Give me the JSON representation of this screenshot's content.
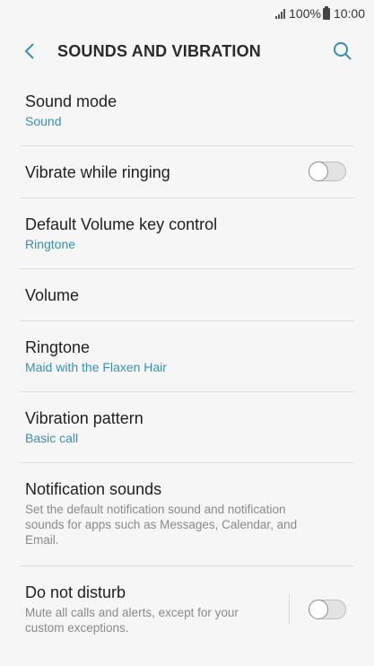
{
  "status": {
    "battery": "100%",
    "time": "10:00"
  },
  "header": {
    "title": "SOUNDS AND VIBRATION"
  },
  "items": {
    "sound_mode": {
      "title": "Sound mode",
      "value": "Sound"
    },
    "vibrate": {
      "title": "Vibrate while ringing",
      "enabled": false
    },
    "volume_key": {
      "title": "Default Volume key control",
      "value": "Ringtone"
    },
    "volume": {
      "title": "Volume"
    },
    "ringtone": {
      "title": "Ringtone",
      "value": "Maid with the Flaxen Hair"
    },
    "vibration_pattern": {
      "title": "Vibration pattern",
      "value": "Basic call"
    },
    "notification_sounds": {
      "title": "Notification sounds",
      "description": "Set the default notification sound and notification sounds for apps such as Messages, Calendar, and Email."
    },
    "dnd": {
      "title": "Do not disturb",
      "description": "Mute all calls and alerts, except for your custom exceptions.",
      "enabled": false
    }
  },
  "colors": {
    "accent": "#3a8eb5",
    "background": "#f6f6f6",
    "divider": "#dcdcdc"
  }
}
